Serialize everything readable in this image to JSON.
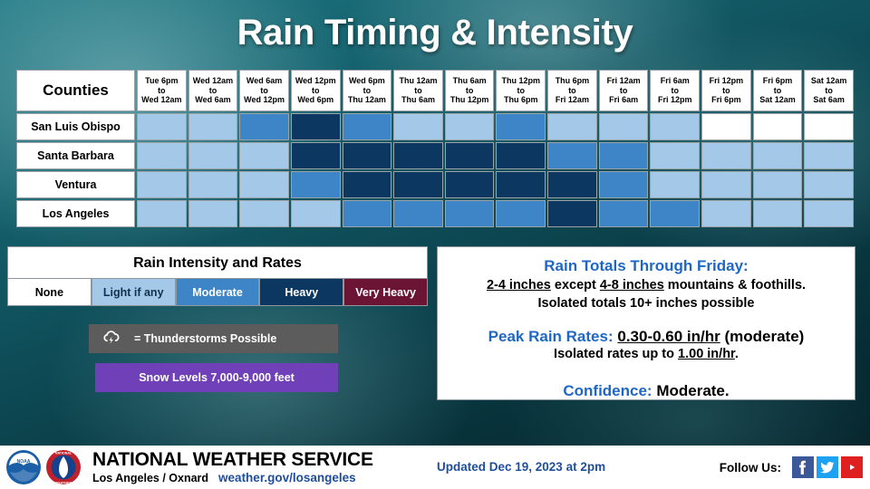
{
  "title": "Rain Timing & Intensity",
  "table": {
    "counties_header": "Counties",
    "periods": [
      "Tue 6pm\nto\nWed 12am",
      "Wed 12am\nto\nWed 6am",
      "Wed 6am\nto\nWed 12pm",
      "Wed 12pm\nto\nWed 6pm",
      "Wed 6pm\nto\nThu 12am",
      "Thu 12am\nto\nThu 6am",
      "Thu 6am\nto\nThu 12pm",
      "Thu 12pm\nto\nThu 6pm",
      "Thu 6pm\nto\nFri 12am",
      "Fri 12am\nto\nFri 6am",
      "Fri 6am\nto\nFri 12pm",
      "Fri 12pm\nto\nFri 6pm",
      "Fri 6pm\nto\nSat 12am",
      "Sat 12am\nto\nSat 6am"
    ],
    "rows": [
      {
        "county": "San Luis Obispo",
        "levels": [
          "light",
          "light",
          "moderate",
          "heavy",
          "moderate",
          "light",
          "light",
          "moderate",
          "light",
          "light",
          "light",
          "none",
          "none",
          "none"
        ]
      },
      {
        "county": "Santa Barbara",
        "levels": [
          "light",
          "light",
          "light",
          "heavy",
          "heavy",
          "heavy",
          "heavy",
          "heavy",
          "moderate",
          "moderate",
          "light",
          "light",
          "light",
          "light"
        ]
      },
      {
        "county": "Ventura",
        "levels": [
          "light",
          "light",
          "light",
          "moderate",
          "heavy",
          "heavy",
          "heavy",
          "heavy",
          "heavy",
          "moderate",
          "light",
          "light",
          "light",
          "light"
        ]
      },
      {
        "county": "Los Angeles",
        "levels": [
          "light",
          "light",
          "light",
          "light",
          "moderate",
          "moderate",
          "moderate",
          "moderate",
          "heavy",
          "moderate",
          "moderate",
          "light",
          "light",
          "light"
        ]
      }
    ]
  },
  "legend": {
    "title": "Rain Intensity and Rates",
    "swatches": [
      {
        "label": "None",
        "level": "none",
        "color": "#ffffff"
      },
      {
        "label": "Light if any",
        "level": "light",
        "color": "#a3c8e8"
      },
      {
        "label": "Moderate",
        "level": "moderate",
        "color": "#3d85c6"
      },
      {
        "label": "Heavy",
        "level": "heavy",
        "color": "#0b3761"
      },
      {
        "label": "Very Heavy",
        "level": "veryheavy",
        "color": "#6b1433"
      }
    ],
    "thunderstorm_label": "= Thunderstorms Possible",
    "snow_label": "Snow Levels 7,000-9,000 feet"
  },
  "info": {
    "totals_heading": "Rain Totals Through Friday:",
    "totals_a": "2-4 inches",
    "totals_mid": " except ",
    "totals_b": "4-8 inches",
    "totals_end": " mountains & foothills.",
    "totals_line2": "Isolated totals 10+ inches possible",
    "rates_heading": "Peak Rain Rates:",
    "rates_value": "0.30-0.60 in/hr",
    "rates_qualifier": " (moderate)",
    "rates_line2_pre": "Isolated rates up to ",
    "rates_line2_value": "1.00 in/hr",
    "rates_line2_post": ".",
    "confidence_heading": "Confidence:",
    "confidence_value": " Moderate."
  },
  "footer": {
    "agency": "NATIONAL WEATHER SERVICE",
    "office": "Los Angeles / Oxnard",
    "url": "weather.gov/losangeles",
    "updated": "Updated Dec 19, 2023 at 2pm",
    "follow_label": "Follow Us:"
  }
}
